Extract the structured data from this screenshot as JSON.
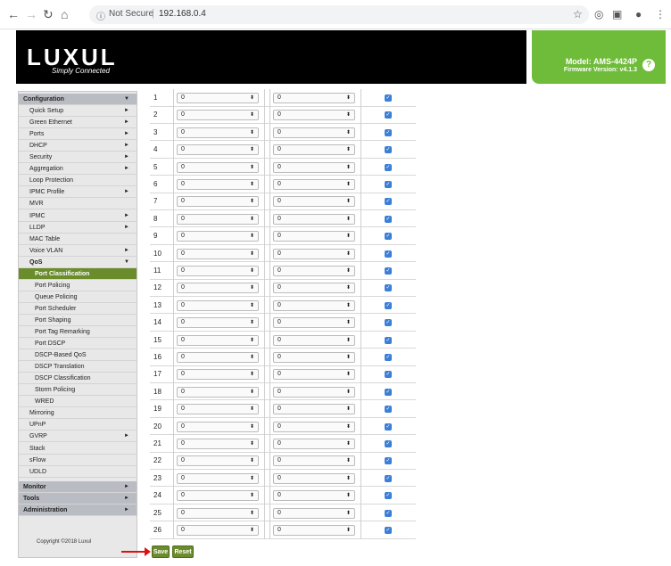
{
  "browser": {
    "url_security": "Not Secure",
    "url": "192.168.0.4"
  },
  "header": {
    "logo": "LUXUL",
    "logo_tagline": "Simply Connected",
    "model": "Model: AMS-4424P",
    "firmware": "Firmware Version: v4.1.3",
    "help": "?"
  },
  "sidebar": {
    "items": [
      {
        "label": "Configuration",
        "type": "section",
        "arrow": "▼"
      },
      {
        "label": "Quick Setup",
        "type": "item",
        "arrow": "►"
      },
      {
        "label": "Green Ethernet",
        "type": "item",
        "arrow": "►"
      },
      {
        "label": "Ports",
        "type": "item",
        "arrow": "►"
      },
      {
        "label": "DHCP",
        "type": "item",
        "arrow": "►"
      },
      {
        "label": "Security",
        "type": "item",
        "arrow": "►"
      },
      {
        "label": "Aggregation",
        "type": "item",
        "arrow": "►"
      },
      {
        "label": "Loop Protection",
        "type": "item",
        "arrow": ""
      },
      {
        "label": "IPMC Profile",
        "type": "item",
        "arrow": "►"
      },
      {
        "label": "MVR",
        "type": "item",
        "arrow": ""
      },
      {
        "label": "IPMC",
        "type": "item",
        "arrow": "►"
      },
      {
        "label": "LLDP",
        "type": "item",
        "arrow": "►"
      },
      {
        "label": "MAC Table",
        "type": "item",
        "arrow": ""
      },
      {
        "label": "Voice VLAN",
        "type": "item",
        "arrow": "►"
      },
      {
        "label": "QoS",
        "type": "qos",
        "arrow": "▼"
      },
      {
        "label": "Port Classification",
        "type": "active",
        "arrow": ""
      },
      {
        "label": "Port Policing",
        "type": "sub",
        "arrow": ""
      },
      {
        "label": "Queue Policing",
        "type": "sub",
        "arrow": ""
      },
      {
        "label": "Port Scheduler",
        "type": "sub",
        "arrow": ""
      },
      {
        "label": "Port Shaping",
        "type": "sub",
        "arrow": ""
      },
      {
        "label": "Port Tag Remarking",
        "type": "sub",
        "arrow": ""
      },
      {
        "label": "Port DSCP",
        "type": "sub",
        "arrow": ""
      },
      {
        "label": "DSCP-Based QoS",
        "type": "sub",
        "arrow": ""
      },
      {
        "label": "DSCP Translation",
        "type": "sub",
        "arrow": ""
      },
      {
        "label": "DSCP Classification",
        "type": "sub",
        "arrow": ""
      },
      {
        "label": "Storm Policing",
        "type": "sub",
        "arrow": ""
      },
      {
        "label": "WRED",
        "type": "sub",
        "arrow": ""
      },
      {
        "label": "Mirroring",
        "type": "item",
        "arrow": ""
      },
      {
        "label": "UPnP",
        "type": "item",
        "arrow": ""
      },
      {
        "label": "GVRP",
        "type": "item",
        "arrow": "►"
      },
      {
        "label": "Stack",
        "type": "item",
        "arrow": ""
      },
      {
        "label": "sFlow",
        "type": "item",
        "arrow": ""
      },
      {
        "label": "UDLD",
        "type": "item",
        "arrow": ""
      },
      {
        "label": "Monitor",
        "type": "section",
        "arrow": "►"
      },
      {
        "label": "Tools",
        "type": "section",
        "arrow": "►"
      },
      {
        "label": "Administration",
        "type": "section",
        "arrow": "►"
      }
    ],
    "copyright": "Copyright ©2018 Luxul"
  },
  "table": {
    "rows": [
      {
        "port": "1",
        "sel1": "0",
        "sel2": "0",
        "checked": true
      },
      {
        "port": "2",
        "sel1": "0",
        "sel2": "0",
        "checked": true
      },
      {
        "port": "3",
        "sel1": "0",
        "sel2": "0",
        "checked": true
      },
      {
        "port": "4",
        "sel1": "0",
        "sel2": "0",
        "checked": true
      },
      {
        "port": "5",
        "sel1": "0",
        "sel2": "0",
        "checked": true
      },
      {
        "port": "6",
        "sel1": "0",
        "sel2": "0",
        "checked": true
      },
      {
        "port": "7",
        "sel1": "0",
        "sel2": "0",
        "checked": true
      },
      {
        "port": "8",
        "sel1": "0",
        "sel2": "0",
        "checked": true
      },
      {
        "port": "9",
        "sel1": "0",
        "sel2": "0",
        "checked": true
      },
      {
        "port": "10",
        "sel1": "0",
        "sel2": "0",
        "checked": true
      },
      {
        "port": "11",
        "sel1": "0",
        "sel2": "0",
        "checked": true
      },
      {
        "port": "12",
        "sel1": "0",
        "sel2": "0",
        "checked": true
      },
      {
        "port": "13",
        "sel1": "0",
        "sel2": "0",
        "checked": true
      },
      {
        "port": "14",
        "sel1": "0",
        "sel2": "0",
        "checked": true
      },
      {
        "port": "15",
        "sel1": "0",
        "sel2": "0",
        "checked": true
      },
      {
        "port": "16",
        "sel1": "0",
        "sel2": "0",
        "checked": true
      },
      {
        "port": "17",
        "sel1": "0",
        "sel2": "0",
        "checked": true
      },
      {
        "port": "18",
        "sel1": "0",
        "sel2": "0",
        "checked": true
      },
      {
        "port": "19",
        "sel1": "0",
        "sel2": "0",
        "checked": true
      },
      {
        "port": "20",
        "sel1": "0",
        "sel2": "0",
        "checked": true
      },
      {
        "port": "21",
        "sel1": "0",
        "sel2": "0",
        "checked": true
      },
      {
        "port": "22",
        "sel1": "0",
        "sel2": "0",
        "checked": true
      },
      {
        "port": "23",
        "sel1": "0",
        "sel2": "0",
        "checked": true
      },
      {
        "port": "24",
        "sel1": "0",
        "sel2": "0",
        "checked": true
      },
      {
        "port": "25",
        "sel1": "0",
        "sel2": "0",
        "checked": true
      },
      {
        "port": "26",
        "sel1": "0",
        "sel2": "0",
        "checked": true
      }
    ]
  },
  "buttons": {
    "save": "Save",
    "reset": "Reset"
  },
  "colors": {
    "accent_green": "#6a8c2b",
    "header_green": "#6fbb3a",
    "checkbox_blue": "#3b7fd6",
    "annotation_arrow": "#dd1111"
  }
}
